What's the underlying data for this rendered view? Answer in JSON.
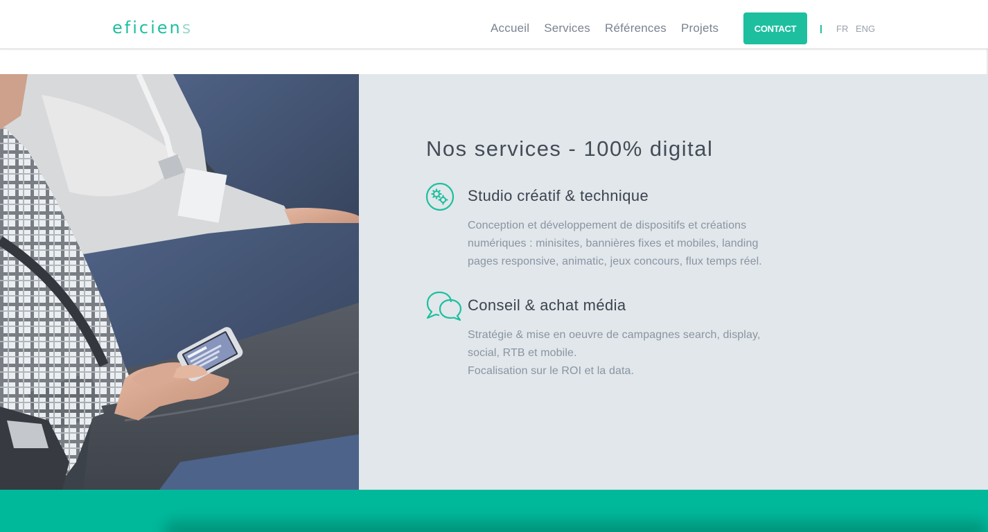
{
  "header": {
    "logo": {
      "main": "eficien",
      "fade": "s"
    },
    "nav": [
      {
        "label": "Accueil"
      },
      {
        "label": "Services"
      },
      {
        "label": "Références"
      },
      {
        "label": "Projets"
      }
    ],
    "contact_label": "CONTACT",
    "lang": {
      "fr": "FR",
      "en": "ENG"
    }
  },
  "hero": {
    "image": "photo of people seated, one holding a smartphone"
  },
  "services": {
    "title": "Nos services - 100% digital",
    "items": [
      {
        "icon": "gears-icon",
        "title": "Studio créatif & technique",
        "lines": [
          "Conception et développement de dispositifs et créations",
          "numériques : minisites, bannières fixes et mobiles, landing",
          "pages responsive, animatic, jeux concours, flux temps réel."
        ]
      },
      {
        "icon": "chat-bubbles-icon",
        "title": "Conseil & achat média",
        "lines": [
          "Stratégie & mise en oeuvre de campagnes search, display,",
          "social, RTB et mobile.",
          "Focalisation sur le ROI et la data."
        ]
      }
    ]
  },
  "colors": {
    "accent": "#1dbf9f",
    "panel": "#e1e7ea",
    "band": "#00b99b",
    "title": "#444c57",
    "body": "#8a94a3",
    "nav": "#7a8290"
  }
}
